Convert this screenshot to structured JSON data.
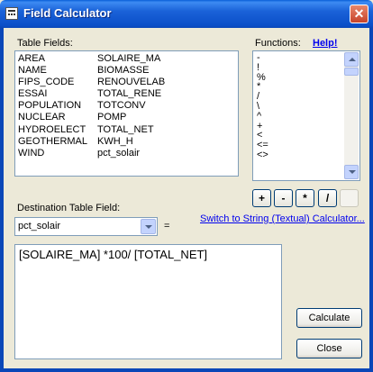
{
  "window": {
    "title": "Field Calculator",
    "close_glyph": "✕"
  },
  "fields_panel": {
    "label": "Table Fields:",
    "column1": [
      "AREA",
      "NAME",
      "FIPS_CODE",
      "ESSAI",
      "POPULATION",
      "NUCLEAR",
      "HYDROELECT",
      "GEOTHERMAL",
      "WIND"
    ],
    "column2": [
      "SOLAIRE_MA",
      "BIOMASSE",
      "RENOUVELAB",
      "TOTAL_RENE",
      "TOTCONV",
      "POMP",
      "TOTAL_NET",
      "KWH_H",
      "pct_solair"
    ]
  },
  "functions_panel": {
    "label": "Functions:",
    "help_link": "Help!",
    "items": [
      "-",
      "!",
      "%",
      "*",
      "/",
      "\\",
      "^",
      "+",
      "<",
      "<=",
      "<>"
    ]
  },
  "operators": [
    "+",
    "-",
    "*",
    "/"
  ],
  "switch_link": "Switch to String (Textual) Calculator...",
  "destination": {
    "label": "Destination Table Field:",
    "value": "pct_solair",
    "equals": "="
  },
  "expression": "[SOLAIRE_MA] *100/ [TOTAL_NET]",
  "buttons": {
    "calculate": "Calculate",
    "close": "Close"
  }
}
